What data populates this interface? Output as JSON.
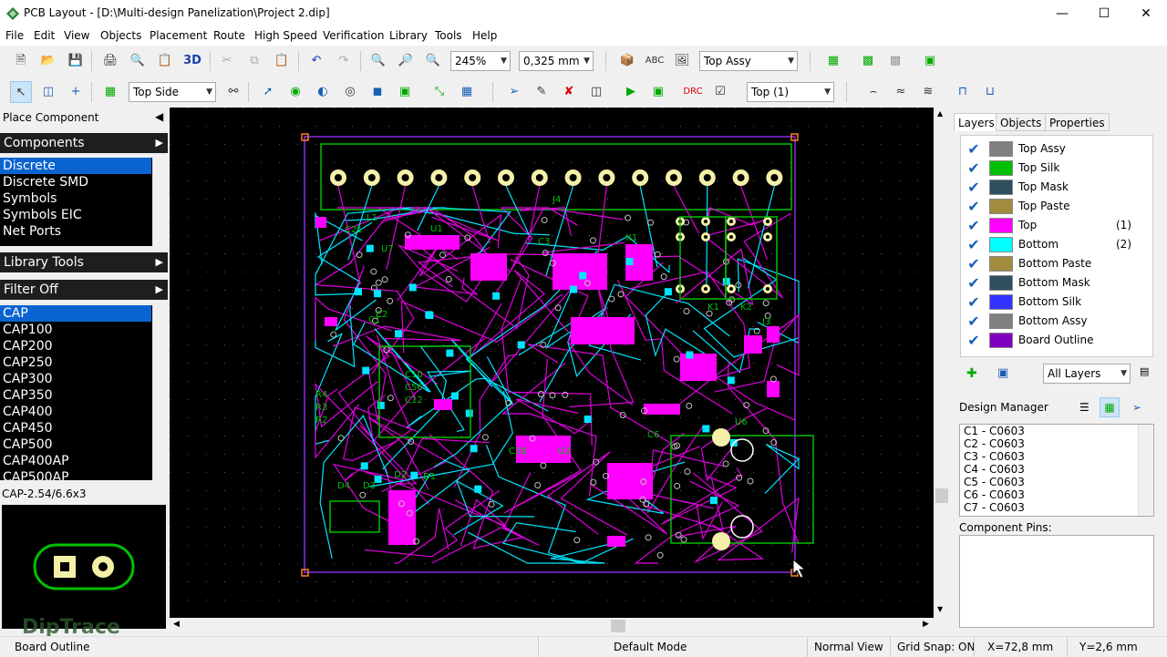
{
  "window": {
    "title": "PCB Layout - [D:\\Multi-design Panelization\\Project 2.dip]"
  },
  "menu": [
    "File",
    "Edit",
    "View",
    "Objects",
    "Placement",
    "Route",
    "High Speed",
    "Verification",
    "Library",
    "Tools",
    "Help"
  ],
  "toolbar1": {
    "zoom": "245%",
    "grid": "0,325 mm",
    "assy_layer": "Top Assy",
    "three_d": "3D"
  },
  "toolbar2": {
    "side": "Top Side",
    "route_layer": "Top (1)"
  },
  "left_panel": {
    "place_component": "Place Component",
    "components_header": "Components",
    "components": [
      "Discrete",
      "Discrete SMD",
      "Symbols",
      "Symbols EIC",
      "Net Ports"
    ],
    "library_tools": "Library Tools",
    "filter": "Filter Off",
    "parts": [
      "CAP",
      "CAP100",
      "CAP200",
      "CAP250",
      "CAP300",
      "CAP350",
      "CAP400",
      "CAP450",
      "CAP500",
      "CAP400AP",
      "CAP500AP"
    ],
    "selected_pattern": "CAP-2.54/6.6x3",
    "logo": "DipTrace"
  },
  "board": {
    "labels": [
      "J4",
      "U7",
      "C21",
      "U1",
      "C2",
      "C1",
      "R4",
      "R3",
      "R2",
      "C10",
      "C56",
      "C12",
      "K1",
      "K2",
      "J3",
      "U6",
      "D4",
      "D3",
      "D2",
      "D1",
      "C6",
      "X1",
      "C3",
      "L1",
      "C28",
      "U2"
    ]
  },
  "right_panel": {
    "tabs": [
      "Layers",
      "Objects",
      "Properties"
    ],
    "layers": [
      {
        "name": "Top Assy",
        "color": "#808080",
        "num": ""
      },
      {
        "name": "Top Silk",
        "color": "#00c000",
        "num": ""
      },
      {
        "name": "Top Mask",
        "color": "#2f4f5f",
        "num": ""
      },
      {
        "name": "Top Paste",
        "color": "#a08c3c",
        "num": ""
      },
      {
        "name": "Top",
        "color": "#ff00ff",
        "num": "(1)"
      },
      {
        "name": "Bottom",
        "color": "#00ffff",
        "num": "(2)"
      },
      {
        "name": "Bottom Paste",
        "color": "#a08c3c",
        "num": ""
      },
      {
        "name": "Bottom Mask",
        "color": "#2f4f5f",
        "num": ""
      },
      {
        "name": "Bottom Silk",
        "color": "#3333ff",
        "num": ""
      },
      {
        "name": "Bottom Assy",
        "color": "#808080",
        "num": ""
      },
      {
        "name": "Board Outline",
        "color": "#8000c0",
        "num": ""
      }
    ],
    "layers_filter": "All Layers",
    "design_manager": "Design Manager",
    "dm_items": [
      "C1 - C0603",
      "C2 - C0603",
      "C3 - C0603",
      "C4 - C0603",
      "C5 - C0603",
      "C6 - C0603",
      "C7 - C0603"
    ],
    "component_pins": "Component Pins:"
  },
  "status": {
    "layer": "Board Outline",
    "mode": "Default Mode",
    "view": "Normal View",
    "grid": "Grid Snap: ON",
    "x": "X=72,8 mm",
    "y": "Y=2,6 mm"
  }
}
